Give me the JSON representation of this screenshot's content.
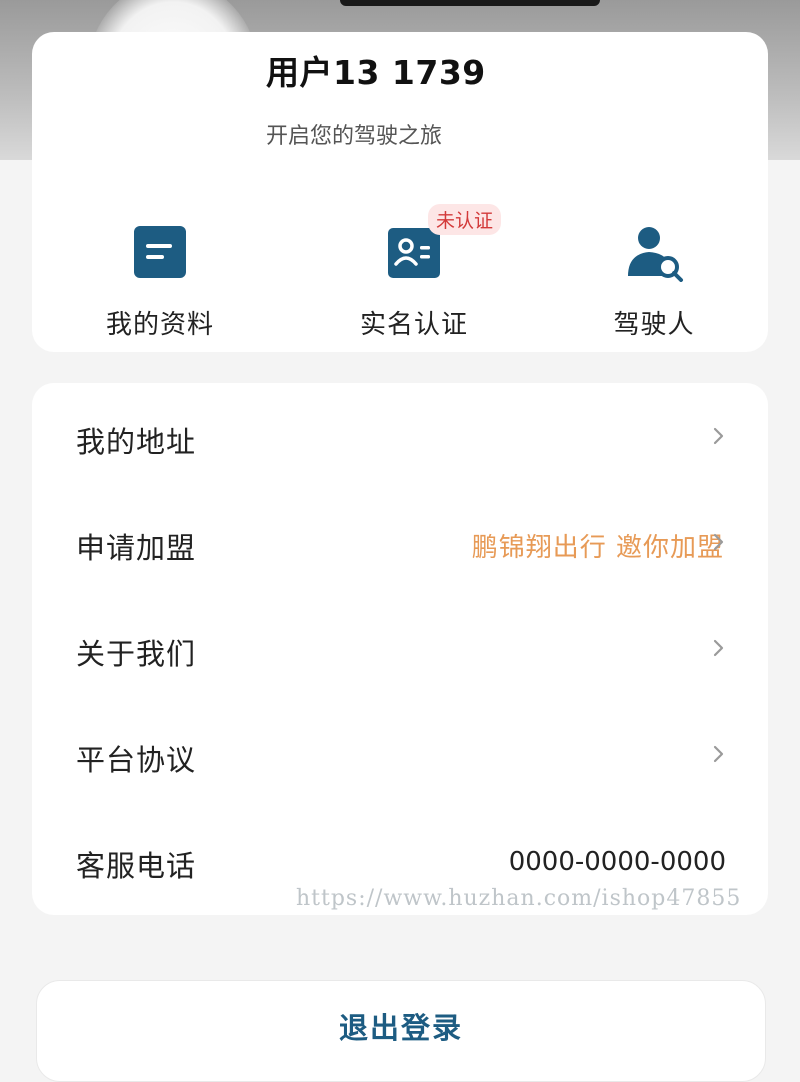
{
  "colors": {
    "accent": "#1d5c82",
    "badge_text": "#d33a3a",
    "link_orange": "#e79a56"
  },
  "profile": {
    "username": "用户13  1739",
    "subtitle": "开启您的驾驶之旅"
  },
  "quick_actions": [
    {
      "label": "我的资料",
      "icon": "profile-card-icon"
    },
    {
      "label": "实名认证",
      "icon": "id-card-icon",
      "badge": "未认证"
    },
    {
      "label": "驾驶人",
      "icon": "driver-search-icon"
    }
  ],
  "menu": {
    "address": "我的地址",
    "join": "申请加盟",
    "join_value": "鹏锦翔出行 邀你加盟",
    "about": "关于我们",
    "agreement": "平台协议",
    "service": "客服电话",
    "service_phone": "0000-0000-0000"
  },
  "watermark": "https://www.huzhan.com/ishop47855",
  "logout_label": "退出登录"
}
